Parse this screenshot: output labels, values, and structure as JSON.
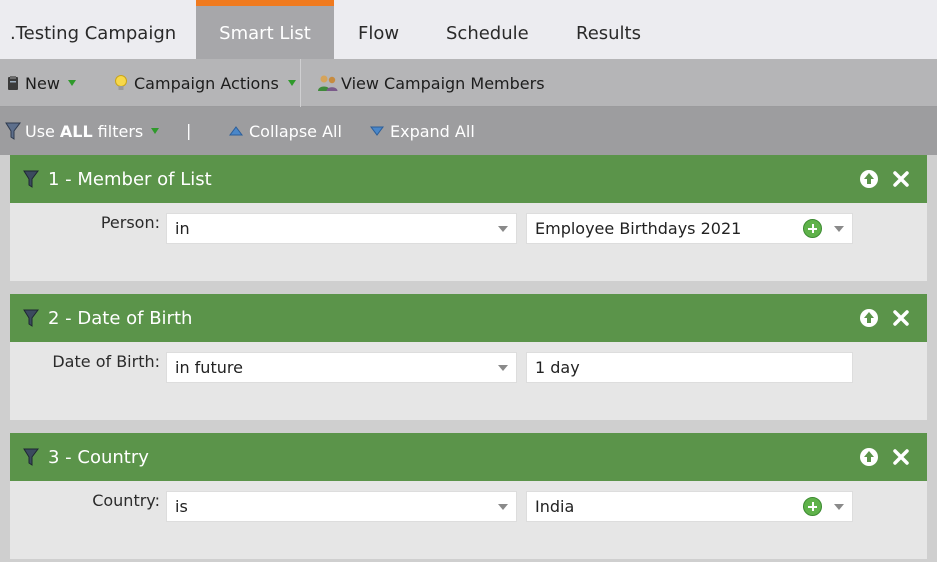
{
  "tabs": [
    {
      "label": ".Testing Campaign",
      "active": false
    },
    {
      "label": "Smart List",
      "active": true
    },
    {
      "label": "Flow",
      "active": false
    },
    {
      "label": "Schedule",
      "active": false
    },
    {
      "label": "Results",
      "active": false
    }
  ],
  "toolbar": {
    "new_label": "New",
    "campaign_actions_label": "Campaign Actions",
    "view_members_label": "View Campaign Members"
  },
  "filter_bar": {
    "use_prefix": "Use",
    "use_bold": "ALL",
    "use_suffix": "filters",
    "separator": "|",
    "collapse_all": "Collapse All",
    "expand_all": "Expand All"
  },
  "filters": [
    {
      "title": "1 - Member of List",
      "field_label": "Person:",
      "operator": "in",
      "value": "Employee Birthdays 2021"
    },
    {
      "title": "2 - Date of Birth",
      "field_label": "Date of Birth:",
      "operator": "in future",
      "value": "1 day"
    },
    {
      "title": "3 - Country",
      "field_label": "Country:",
      "operator": "is",
      "value": "India"
    }
  ],
  "colors": {
    "accent_tab": "#f07a1e",
    "filter_header": "#5b944a",
    "add_button": "#5fb24a"
  }
}
